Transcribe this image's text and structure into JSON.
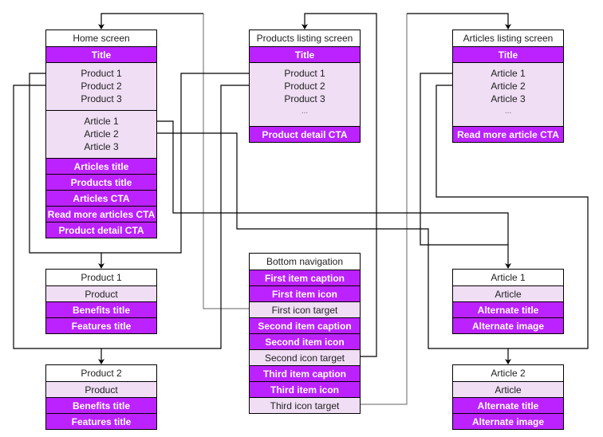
{
  "colors": {
    "primary_row": "#BC22FF",
    "secondary_row": "#F0DEF5",
    "header_row": "#FFFFFF",
    "connector": "#000000",
    "connector_gray": "#808080"
  },
  "boxes": {
    "home": {
      "title": "Home screen",
      "rows": [
        {
          "style": "purple",
          "text": "Title"
        },
        {
          "style": "list",
          "items": [
            "Product 1",
            "Product 2",
            "Product 3"
          ]
        },
        {
          "style": "list",
          "items": [
            "Article 1",
            "Article 2",
            "Article 3"
          ]
        },
        {
          "style": "purple",
          "text": "Articles title"
        },
        {
          "style": "purple",
          "text": "Products title"
        },
        {
          "style": "purple",
          "text": "Articles CTA"
        },
        {
          "style": "purple",
          "text": "Read more articles CTA"
        },
        {
          "style": "purple",
          "text": "Product detail CTA"
        }
      ]
    },
    "products_listing": {
      "title": "Products listing screen",
      "rows": [
        {
          "style": "purple",
          "text": "Title"
        },
        {
          "style": "list",
          "items": [
            "Product 1",
            "Product 2",
            "Product 3"
          ],
          "more": "..."
        },
        {
          "style": "purple",
          "text": "Product detail CTA"
        }
      ]
    },
    "articles_listing": {
      "title": "Articles listing screen",
      "rows": [
        {
          "style": "purple",
          "text": "Title"
        },
        {
          "style": "list",
          "items": [
            "Article 1",
            "Article 2",
            "Article 3"
          ],
          "more": "..."
        },
        {
          "style": "purple",
          "text": "Read more article CTA"
        }
      ]
    },
    "product1": {
      "title": "Product 1",
      "rows": [
        {
          "style": "light",
          "text": "Product"
        },
        {
          "style": "purple",
          "text": "Benefits title"
        },
        {
          "style": "purple",
          "text": "Features title"
        }
      ]
    },
    "product2": {
      "title": "Product 2",
      "rows": [
        {
          "style": "light",
          "text": "Product"
        },
        {
          "style": "purple",
          "text": "Benefits title"
        },
        {
          "style": "purple",
          "text": "Features title"
        }
      ]
    },
    "bottom_nav": {
      "title": "Bottom navigation",
      "rows": [
        {
          "style": "purple",
          "text": "First item caption"
        },
        {
          "style": "purple",
          "text": "First item icon"
        },
        {
          "style": "light",
          "text": "First icon target"
        },
        {
          "style": "purple",
          "text": "Second item caption"
        },
        {
          "style": "purple",
          "text": "Second item icon"
        },
        {
          "style": "light",
          "text": "Second icon target"
        },
        {
          "style": "purple",
          "text": "Third item caption"
        },
        {
          "style": "purple",
          "text": "Third item icon"
        },
        {
          "style": "light",
          "text": "Third icon target"
        }
      ]
    },
    "article1": {
      "title": "Article 1",
      "rows": [
        {
          "style": "light",
          "text": "Article"
        },
        {
          "style": "purple",
          "text": "Alternate title"
        },
        {
          "style": "purple",
          "text": "Alternate image"
        }
      ]
    },
    "article2": {
      "title": "Article 2",
      "rows": [
        {
          "style": "light",
          "text": "Article"
        },
        {
          "style": "purple",
          "text": "Alternate title"
        },
        {
          "style": "purple",
          "text": "Alternate image"
        }
      ]
    }
  }
}
